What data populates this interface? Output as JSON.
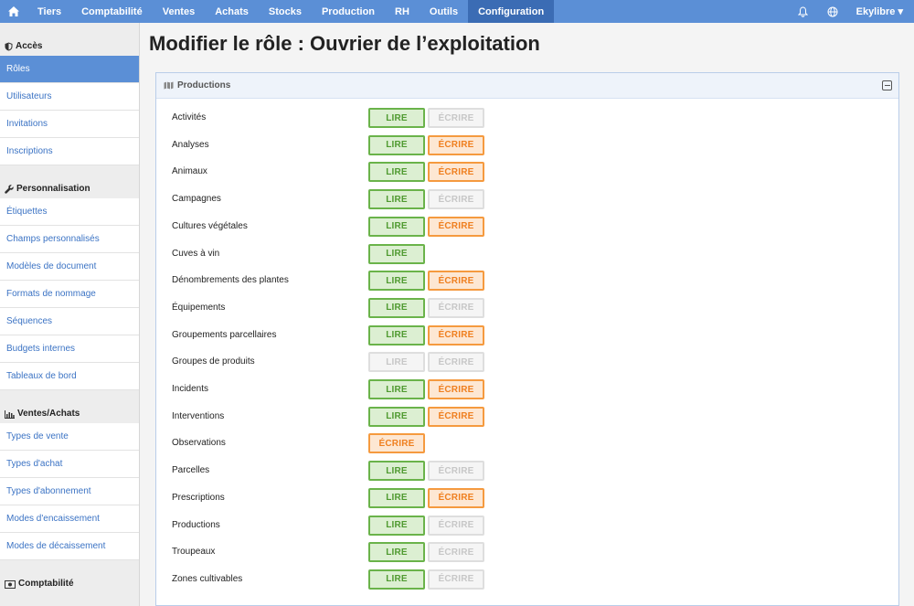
{
  "topnav": {
    "items": [
      "Tiers",
      "Comptabilité",
      "Ventes",
      "Achats",
      "Stocks",
      "Production",
      "RH",
      "Outils",
      "Configuration"
    ],
    "active": "Configuration",
    "user": "Ekylibre ▾",
    "icons": [
      "home-icon",
      "bell-icon",
      "globe-icon"
    ],
    "color": "#5b8fd6",
    "active_color": "#3b6cb4"
  },
  "sidebar": {
    "sections": [
      {
        "title": "Accès",
        "icon": "shield-icon",
        "items": [
          "Rôles",
          "Utilisateurs",
          "Invitations",
          "Inscriptions"
        ]
      },
      {
        "title": "Personnalisation",
        "icon": "wrench-icon",
        "items": [
          "Étiquettes",
          "Champs personnalisés",
          "Modèles de document",
          "Formats de nommage",
          "Séquences",
          "Budgets internes",
          "Tableaux de bord"
        ]
      },
      {
        "title": "Ventes/Achats",
        "icon": "bar-chart-icon",
        "items": [
          "Types de vente",
          "Types d'achat",
          "Types d'abonnement",
          "Modes d'encaissement",
          "Modes de décaissement"
        ]
      },
      {
        "title": "Comptabilité",
        "icon": "money-icon",
        "items": []
      }
    ],
    "active_item": "Rôles"
  },
  "page": {
    "title": "Modifier le rôle : Ouvrier de l’exploitation"
  },
  "panel": {
    "title": "Productions",
    "icon": "map-icon",
    "read_label": "LIRE",
    "write_label": "ÉCRIRE",
    "rows": [
      {
        "label": "Activités",
        "read": true,
        "write": false,
        "has_read": true,
        "has_write": true
      },
      {
        "label": "Analyses",
        "read": true,
        "write": true,
        "has_read": true,
        "has_write": true
      },
      {
        "label": "Animaux",
        "read": true,
        "write": true,
        "has_read": true,
        "has_write": true
      },
      {
        "label": "Campagnes",
        "read": true,
        "write": false,
        "has_read": true,
        "has_write": true
      },
      {
        "label": "Cultures végétales",
        "read": true,
        "write": true,
        "has_read": true,
        "has_write": true
      },
      {
        "label": "Cuves à vin",
        "read": true,
        "write": false,
        "has_read": true,
        "has_write": false
      },
      {
        "label": "Dénombrements des plantes",
        "read": true,
        "write": true,
        "has_read": true,
        "has_write": true
      },
      {
        "label": "Équipements",
        "read": true,
        "write": false,
        "has_read": true,
        "has_write": true
      },
      {
        "label": "Groupements parcellaires",
        "read": true,
        "write": true,
        "has_read": true,
        "has_write": true
      },
      {
        "label": "Groupes de produits",
        "read": false,
        "write": false,
        "has_read": true,
        "has_write": true
      },
      {
        "label": "Incidents",
        "read": true,
        "write": true,
        "has_read": true,
        "has_write": true
      },
      {
        "label": "Interventions",
        "read": true,
        "write": true,
        "has_read": true,
        "has_write": true
      },
      {
        "label": "Observations",
        "read": false,
        "write": true,
        "has_read": false,
        "has_write": true
      },
      {
        "label": "Parcelles",
        "read": true,
        "write": false,
        "has_read": true,
        "has_write": true
      },
      {
        "label": "Prescriptions",
        "read": true,
        "write": true,
        "has_read": true,
        "has_write": true
      },
      {
        "label": "Productions",
        "read": true,
        "write": false,
        "has_read": true,
        "has_write": true
      },
      {
        "label": "Troupeaux",
        "read": true,
        "write": false,
        "has_read": true,
        "has_write": true
      },
      {
        "label": "Zones cultivables",
        "read": true,
        "write": false,
        "has_read": true,
        "has_write": true
      }
    ]
  },
  "colors": {
    "read_on": "#6ab34a",
    "write_on": "#f59a3f",
    "off": "#dedede",
    "link": "#3b73c4"
  }
}
